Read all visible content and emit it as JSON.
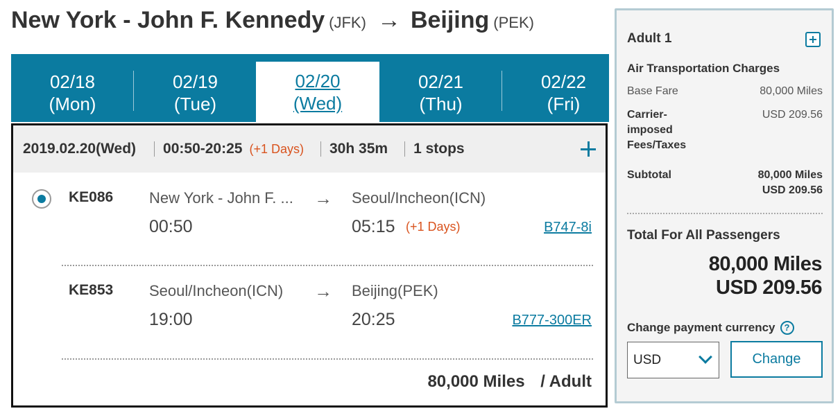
{
  "route": {
    "origin_city": "New York - John F. Kennedy",
    "origin_code": "(JFK)",
    "arrow": "→",
    "dest_city": "Beijing",
    "dest_code": "(PEK)"
  },
  "date_tabs": [
    {
      "date": "02/18",
      "day": "(Mon)"
    },
    {
      "date": "02/19",
      "day": "(Tue)"
    },
    {
      "date": "02/20",
      "day": "(Wed)",
      "selected": true
    },
    {
      "date": "02/21",
      "day": "(Thu)"
    },
    {
      "date": "02/22",
      "day": "(Fri)"
    }
  ],
  "itinerary": {
    "date": "2019.02.20(Wed)",
    "time_range": "00:50-20:25",
    "plus_days": "(+1 Days)",
    "duration": "30h 35m",
    "stops": "1 stops",
    "segments": [
      {
        "flight": "KE086",
        "from": "New York - John F. ...",
        "to": "Seoul/Incheon(ICN)",
        "depart": "00:50",
        "arrive": "05:15",
        "arrive_plus": "(+1 Days)",
        "aircraft": "B747-8i"
      },
      {
        "flight": "KE853",
        "from": "Seoul/Incheon(ICN)",
        "to": "Beijing(PEK)",
        "depart": "19:00",
        "arrive": "20:25",
        "aircraft": "B777-300ER"
      }
    ],
    "price": "80,000 Miles",
    "per": "/ Adult"
  },
  "fare": {
    "passenger": "Adult 1",
    "section": "Air Transportation Charges",
    "base_fare_label": "Base Fare",
    "base_fare_value": "80,000 Miles",
    "taxes_label_1": "Carrier-",
    "taxes_label_2": "imposed",
    "taxes_label_3": "Fees/Taxes",
    "taxes_value": "USD 209.56",
    "subtotal_label": "Subtotal",
    "subtotal_miles": "80,000 Miles",
    "subtotal_usd": "USD 209.56",
    "total_label": "Total For All Passengers",
    "total_miles": "80,000 Miles",
    "total_usd": "USD 209.56",
    "currency_label": "Change payment currency",
    "help_glyph": "?",
    "currency_value": "USD",
    "change_button": "Change"
  },
  "colors": {
    "accent": "#0b7ba0",
    "highlight": "#d9531e"
  }
}
